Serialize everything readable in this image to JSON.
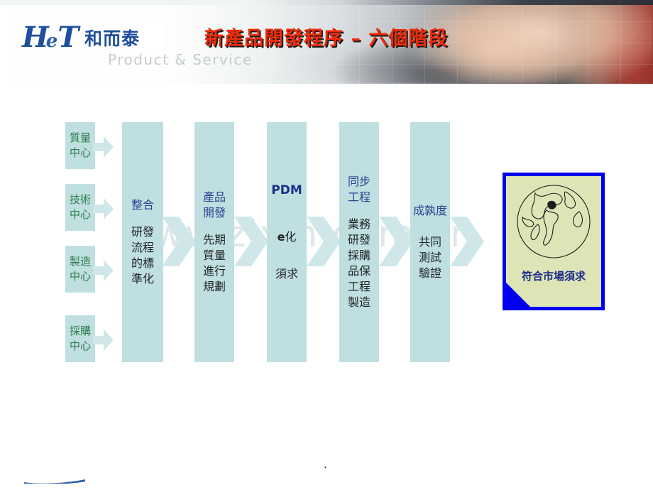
{
  "header": {
    "logo": {
      "mark_h": "H",
      "mark_e": "e",
      "mark_t": "T",
      "brand_cn": "和而泰",
      "tagline": "Product & Service"
    },
    "title": "新產品開發程序 – 六個階段",
    "title_color": "#ef2b0a",
    "photo_alt": "hands-typing-on-keyboard"
  },
  "watermark": {
    "text": "www.zixin.com.cn"
  },
  "diagram": {
    "side_labels": [
      {
        "text": "質量\n中心",
        "color": "#2e7d4f"
      },
      {
        "text": "技術\n中心",
        "color": "#2e7d4f"
      },
      {
        "text": "製造\n中心",
        "color": "#2e7d4f"
      },
      {
        "text": "採購\n中心",
        "color": "#2e7d4f"
      }
    ],
    "stages": [
      {
        "head": "整合",
        "body": "研發\n流程\n的標\n準化"
      },
      {
        "head": "產品\n開發",
        "body": "先期\n質量\n進行\n規劃"
      },
      {
        "head": "PDM",
        "body_bold": "e",
        "body_rest": "化",
        "body_line2": "須求"
      },
      {
        "head": "同步\n工程",
        "body": "業務\n研發\n採購\n品保\n工程\n製造"
      },
      {
        "head": "成孰度",
        "body": "共同\n測試\n驗證"
      }
    ],
    "result": {
      "label": "符合市場須求",
      "icon": "globe-icon",
      "border_color": "#0000ee",
      "fill_color": "#dde5b6"
    },
    "panel_color": "#bfdfe0",
    "arrow_color": "#cfe7e8"
  },
  "footer": {
    "page_mark": "."
  }
}
